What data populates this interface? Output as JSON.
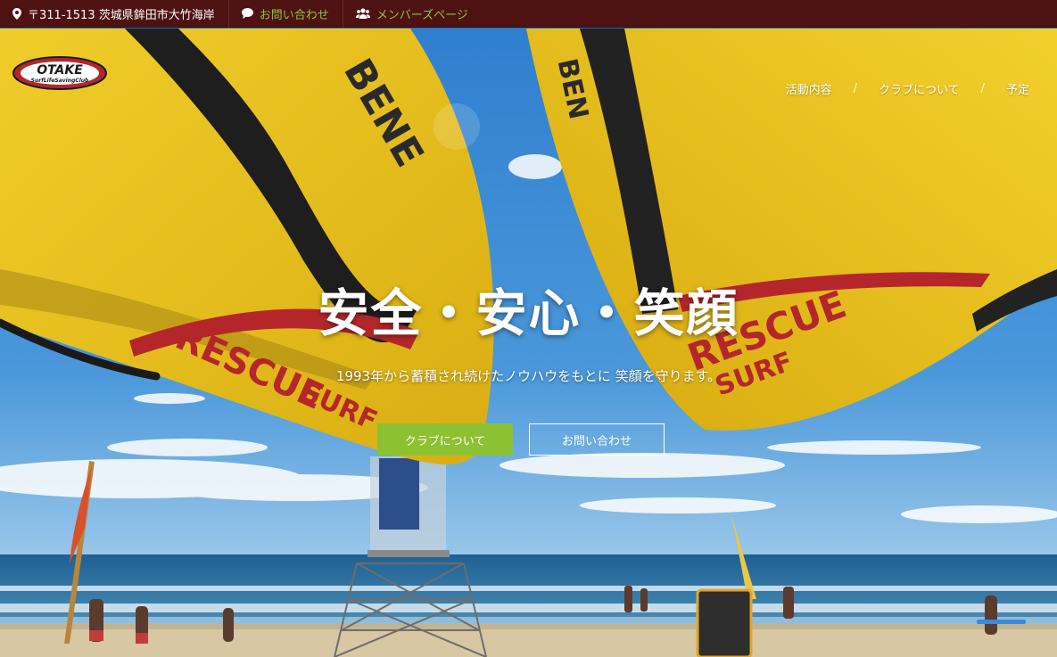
{
  "topbar": {
    "address": "〒311-1513 茨城県鉾田市大竹海岸",
    "contact": "お問い合わせ",
    "members": "メンバーズページ"
  },
  "logo": {
    "name": "OTAKE",
    "sub": "SurfLifeSavingClub"
  },
  "nav": {
    "items": [
      "活動内容",
      "クラブについて",
      "予定"
    ],
    "separator": "/"
  },
  "hero": {
    "headline": "安全・安心・笑顔",
    "subline": "1993年から蓄積され続けたノウハウをもとに 笑顔を守ります。",
    "primary_button": "クラブについて",
    "secondary_button": "お問い合わせ"
  },
  "colors": {
    "topbar_bg": "#4e1212",
    "accent_green": "#8cc132",
    "board_yellow": "#e8c21c",
    "board_red": "#b5262b"
  }
}
